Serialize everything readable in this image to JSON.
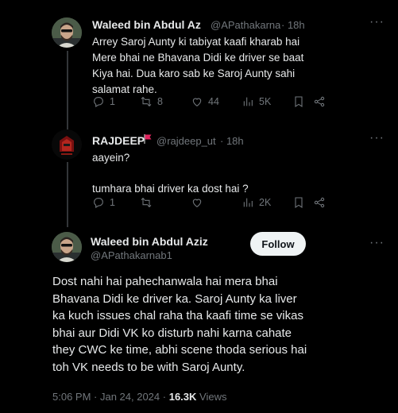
{
  "tweet1": {
    "name": "Waleed bin Abdul Az",
    "handle": "@APathakarnat",
    "time": "· 18h",
    "lines": [
      "Arrey Saroj Aunty ki tabiyat kaafi kharab hai",
      "Mere bhai ne Bhavana Didi ke driver se baat",
      "Kiya hai. Dua karo sab ke Saroj Aunty sahi",
      "salamat rahe."
    ],
    "replies": "1",
    "retweets": "8",
    "likes": "44",
    "views": "5K"
  },
  "tweet2": {
    "name": "RAJDEEP",
    "handle": "@rajdeep_ut",
    "time": "· 18h",
    "line1": "aayein?",
    "line2": "tumhara bhai driver ka dost hai ?",
    "replies": "1",
    "views": "2K",
    "flag_color": "#e0245e"
  },
  "main": {
    "name": "Waleed bin Abdul Aziz",
    "handle": "@APathakarnab1",
    "follow": "Follow",
    "lines": [
      "Dost nahi hai pahechanwala hai mera bhai",
      "Bhavana Didi ke driver ka. Saroj Aunty ka liver",
      "ka kuch issues chal raha tha kaafi time se vikas",
      "bhai aur Didi VK ko disturb nahi karna cahate",
      "they CWC ke time, abhi scene thoda serious hai",
      "toh VK needs to be with Saroj Aunty."
    ],
    "timestamp": "5:06 PM · Jan 24, 2024 ·",
    "views_count": "16.3K",
    "views_label": "Views"
  },
  "icons": [
    "reply-icon",
    "retweet-icon",
    "like-icon",
    "views-icon",
    "bookmark-icon",
    "share-icon",
    "more-icon"
  ]
}
